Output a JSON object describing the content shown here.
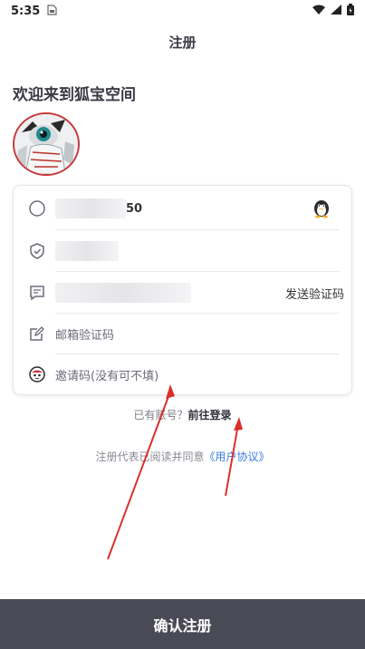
{
  "status": {
    "time": "5:35",
    "left_icon": "sim-card-icon",
    "right_icons": [
      "wifi-icon",
      "signal-icon",
      "battery-icon"
    ]
  },
  "header": {
    "title": "注册"
  },
  "welcome": {
    "text": "欢迎来到狐宝空间"
  },
  "form": {
    "phone": {
      "visible_suffix": "50",
      "icon": "phone-circle-icon",
      "side_icon": "qq-penguin-icon"
    },
    "captcha": {
      "icon": "shield-check-icon"
    },
    "sms_code": {
      "icon": "message-icon",
      "send_label": "发送验证码"
    },
    "email_code": {
      "icon": "edit-icon",
      "placeholder": "邮箱验证码"
    },
    "invite_code": {
      "icon": "mascot-icon",
      "placeholder": "邀请码(没有可不填)"
    }
  },
  "login_prompt": {
    "text": "已有账号？",
    "link": "前往登录"
  },
  "agreement": {
    "text": "注册代表已阅读并同意",
    "link": "《用户协议》"
  },
  "submit": {
    "label": "确认注册"
  },
  "colors": {
    "button_bg": "#4a4a56",
    "link_blue": "#3a7be0",
    "arrow_red": "#d9302a",
    "avatar_border": "#c7373b"
  }
}
